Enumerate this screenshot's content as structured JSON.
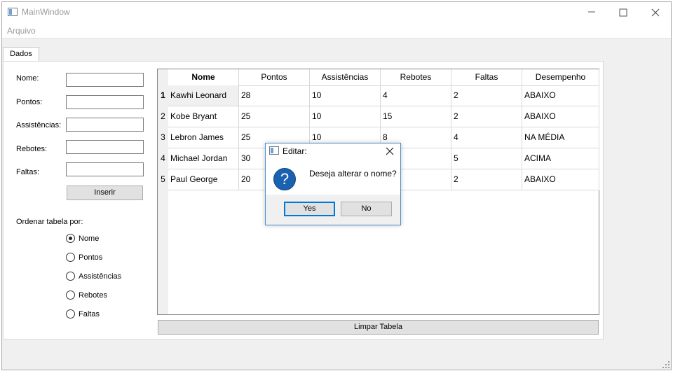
{
  "window": {
    "title": "MainWindow",
    "menu": [
      "Arquivo"
    ]
  },
  "tabs": [
    "Dados"
  ],
  "form": {
    "fields": [
      {
        "label": "Nome:",
        "value": ""
      },
      {
        "label": "Pontos:",
        "value": ""
      },
      {
        "label": "Assistências:",
        "value": ""
      },
      {
        "label": "Rebotes:",
        "value": ""
      },
      {
        "label": "Faltas:",
        "value": ""
      }
    ],
    "insert_button": "Inserir",
    "sort_label": "Ordenar tabela por:",
    "sort_options": [
      "Nome",
      "Pontos",
      "Assistências",
      "Rebotes",
      "Faltas"
    ],
    "sort_selected": "Nome"
  },
  "table": {
    "columns": [
      "Nome",
      "Pontos",
      "Assistências",
      "Rebotes",
      "Faltas",
      "Desempenho"
    ],
    "row_headers": [
      "1",
      "2",
      "3",
      "4",
      "5"
    ],
    "rows": [
      [
        "Kawhi Leonard",
        "28",
        "10",
        "4",
        "2",
        "ABAIXO"
      ],
      [
        "Kobe Bryant",
        "25",
        "10",
        "15",
        "2",
        "ABAIXO"
      ],
      [
        "Lebron James",
        "25",
        "10",
        "8",
        "4",
        "NA MÉDIA"
      ],
      [
        "Michael Jordan",
        "30",
        "",
        "",
        "5",
        "ACIMA"
      ],
      [
        "Paul George",
        "20",
        "",
        "",
        "2",
        "ABAIXO"
      ]
    ],
    "clear_button": "Limpar Tabela"
  },
  "dialog": {
    "title": "Editar:",
    "message": "Deseja alterar o nome?",
    "icon": "question-icon",
    "yes_label": "Yes",
    "no_label": "No"
  },
  "colors": {
    "dialog_accent": "#0078d7",
    "question_icon": "#1a62b0"
  }
}
